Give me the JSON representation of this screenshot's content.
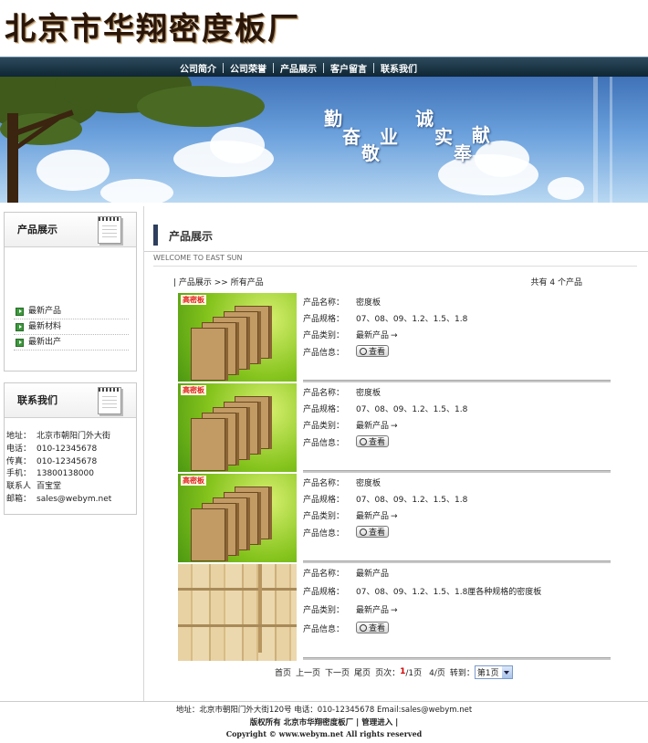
{
  "site": {
    "logo": "北京市华翔密度板厂"
  },
  "nav": [
    "公司简介",
    "公司荣誉",
    "产品展示",
    "客户留言",
    "联系我们"
  ],
  "banner": {
    "slogan": [
      "勤",
      "奋",
      "敬",
      "业",
      "诚",
      "实",
      "奉",
      "献"
    ]
  },
  "sidebar": {
    "products_title": "产品展示",
    "categories": [
      "最新产品",
      "最新材料",
      "最新出产"
    ],
    "contact_title": "联系我们",
    "contact": [
      {
        "label": "地址：",
        "value": "北京市朝阳门外大街"
      },
      {
        "label": "电话：",
        "value": "010-12345678"
      },
      {
        "label": "传真：",
        "value": "010-12345678"
      },
      {
        "label": "手机：",
        "value": "13800138000"
      },
      {
        "label": "联系人",
        "value": "百宝堂"
      },
      {
        "label": "邮箱：",
        "value": "sales@webym.net"
      }
    ]
  },
  "main": {
    "title": "产品展示",
    "welcome": "WELCOME TO EAST SUN",
    "breadcrumb": "| 产品展示 >> 所有产品",
    "total": "共有 4 个产品",
    "field_labels": {
      "name": "产品名称：",
      "spec": "产品规格：",
      "category": "产品类别：",
      "info": "产品信息："
    },
    "view_label": "查看",
    "badge": "高密板",
    "products": [
      {
        "name": "密度板",
        "spec": "07、08、09、1.2、1.5、1.8",
        "category": "最新产品"
      },
      {
        "name": "密度板",
        "spec": "07、08、09、1.2、1.5、1.8",
        "category": "最新产品"
      },
      {
        "name": "密度板",
        "spec": "07、08、09、1.2、1.5、1.8",
        "category": "最新产品"
      },
      {
        "name": "最新产品",
        "spec": "07、08、09、1.2、1.5、1.8厘各种规格的密度板",
        "category": "最新产品"
      }
    ],
    "pager": {
      "first": "首页",
      "prev": "上一页",
      "next": "下一页",
      "last": "尾页",
      "pages_label": "页次：",
      "current": "1",
      "total_pages": "/1页",
      "per_page": "4/页",
      "goto_label": "转到：",
      "select_value": "第1页"
    }
  },
  "footer": {
    "address": "地址：北京市朝阳门外大街120号 电话：010-12345678 Email:sales@webym.net",
    "copyright_cn": "版权所有 北京市华翔密度板厂 | 管理进入 |",
    "copyright_en": "Copyright © www.webym.net All rights reserved"
  }
}
